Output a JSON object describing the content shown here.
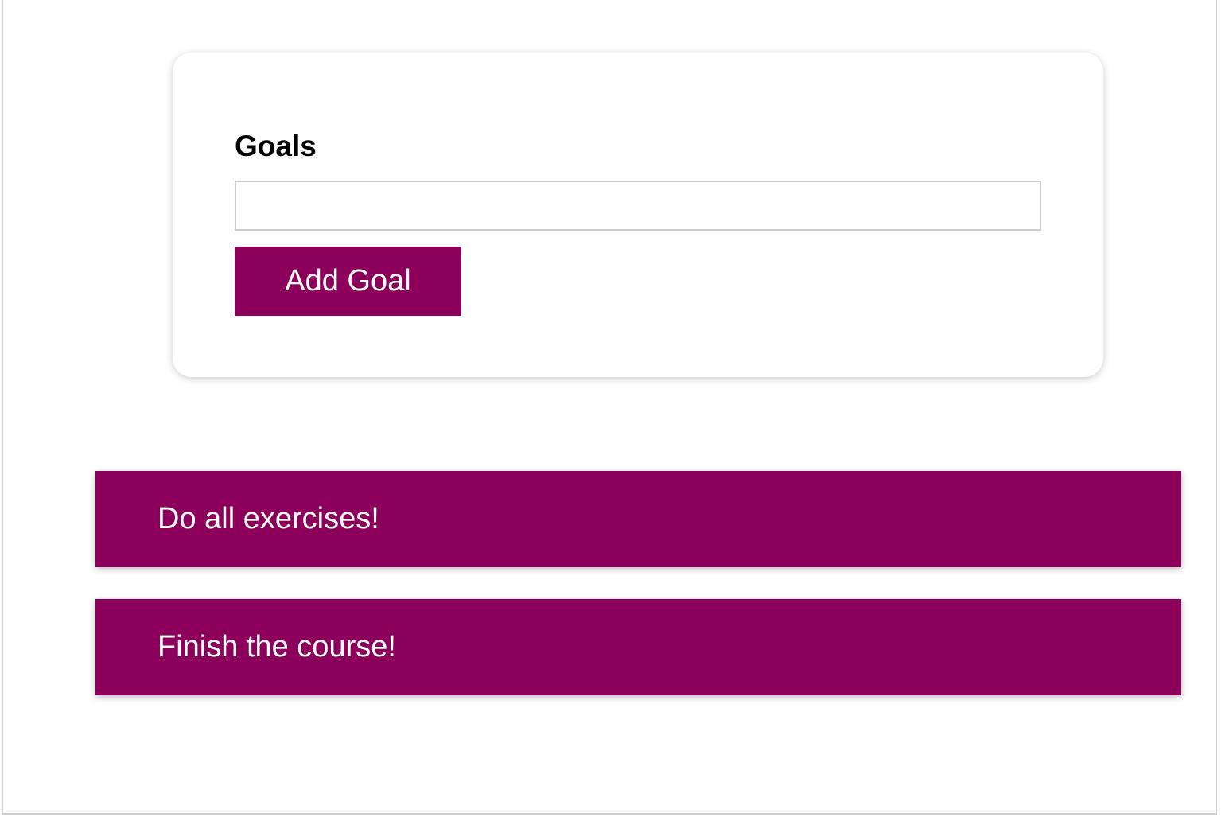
{
  "form": {
    "label": "Goals",
    "input_value": "",
    "input_placeholder": "",
    "button_label": "Add Goal"
  },
  "goals": [
    {
      "text": "Do all exercises!"
    },
    {
      "text": "Finish the course!"
    }
  ],
  "colors": {
    "accent": "#8c005c",
    "text_on_accent": "#ffffff",
    "background": "#ffffff"
  }
}
